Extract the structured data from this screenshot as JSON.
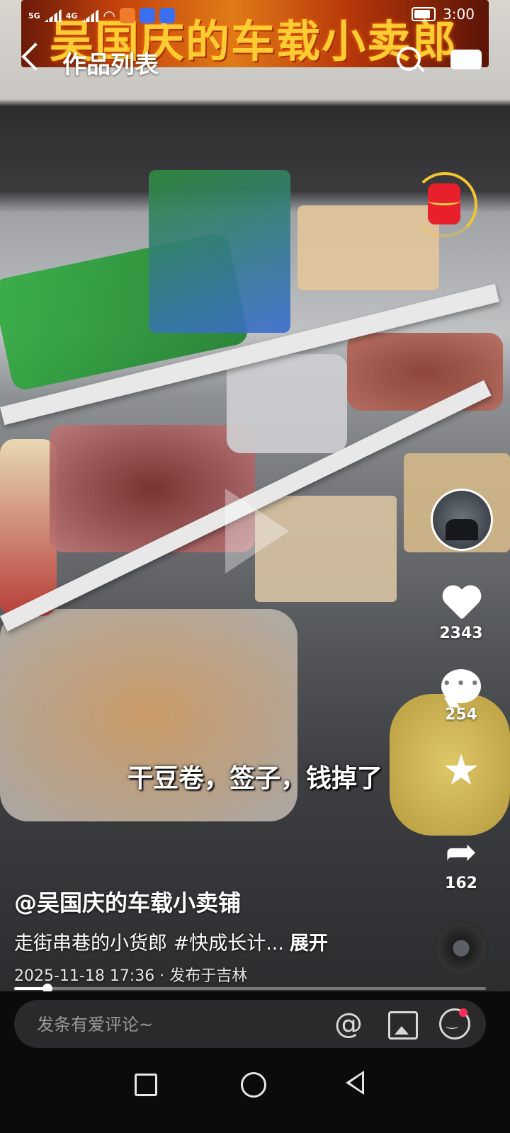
{
  "status_bar": {
    "network_1": "5G",
    "network_2": "4G",
    "time": "3:00"
  },
  "video": {
    "banner_text": "吴国庆的车载小卖郎",
    "subtitle": "干豆卷，签子，钱掉了"
  },
  "top_nav": {
    "title": "作品列表"
  },
  "actions": {
    "likes": "2343",
    "comments": "254",
    "shares": "162"
  },
  "post": {
    "author": "@吴国庆的车载小卖铺",
    "description": "走街串巷的小货郎 #快成长计...",
    "expand_label": "展开",
    "meta": "2025-11-18 17:36 · 发布于吉林",
    "progress_fraction": 0.07
  },
  "comment_bar": {
    "placeholder": "发条有爱评论~",
    "at_symbol": "@"
  },
  "colors": {
    "accent_red": "#e8202c",
    "timer_ring": "#f4c531",
    "notification_dot": "#ff2d55"
  }
}
